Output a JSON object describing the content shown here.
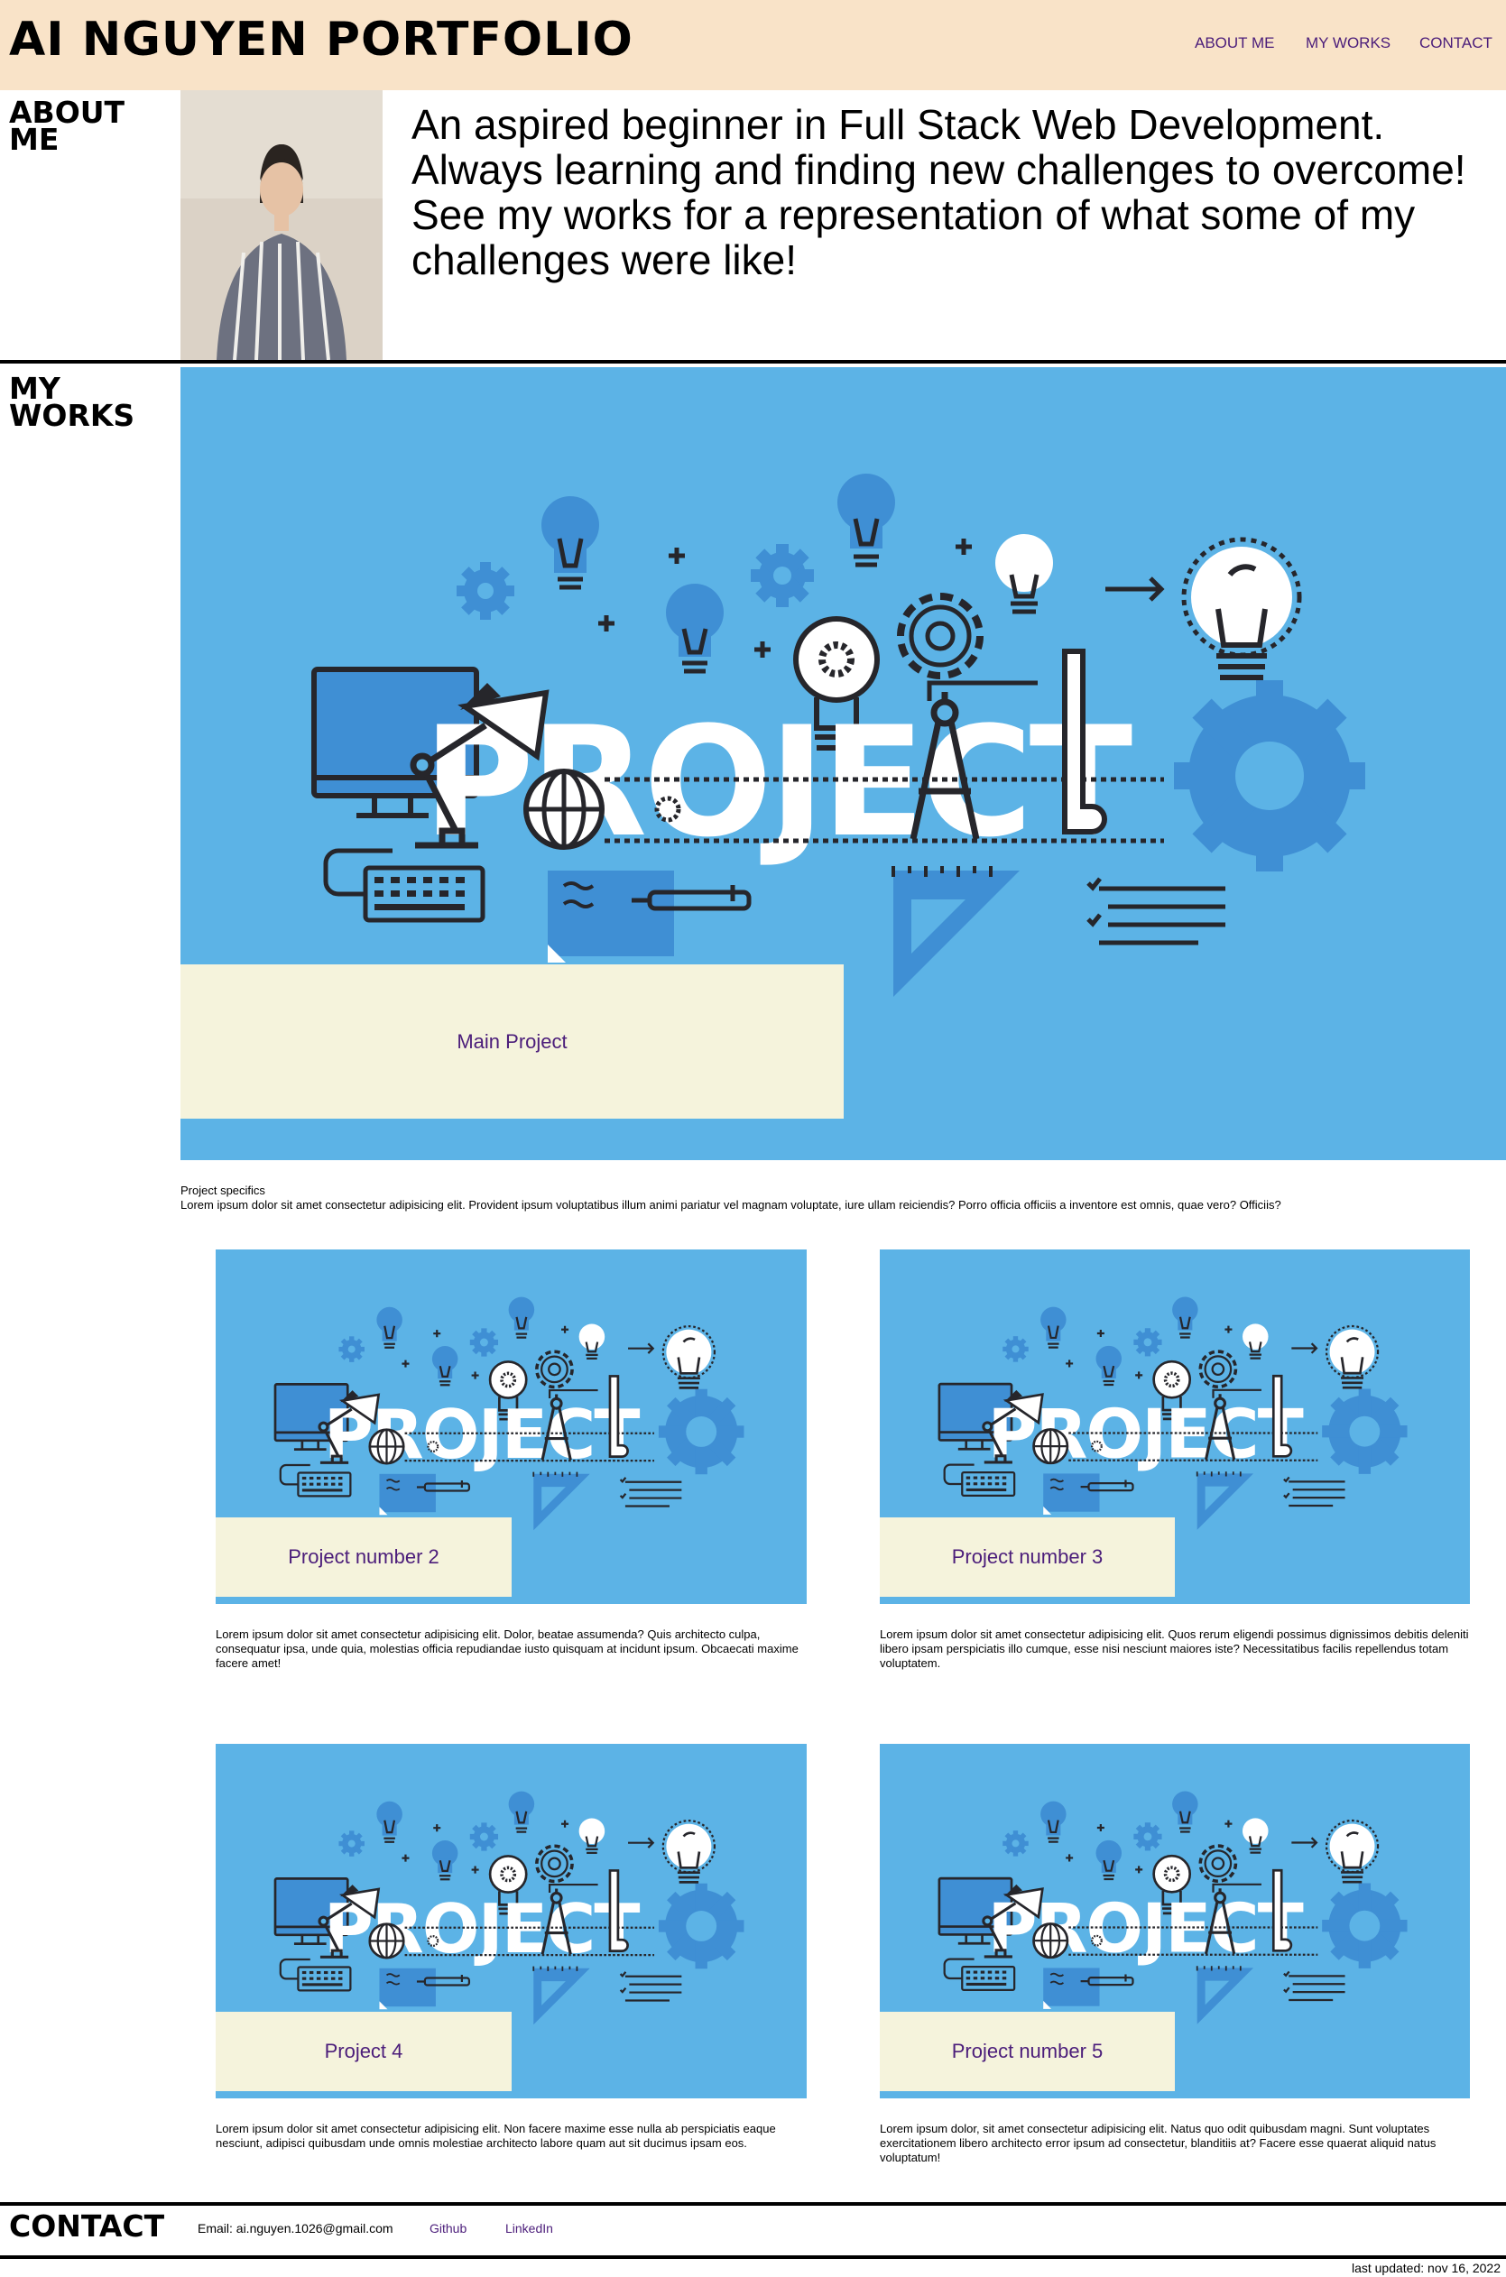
{
  "header": {
    "title": "AI NGUYEN PORTFOLIO",
    "nav": [
      "ABOUT ME",
      "MY WORKS",
      "CONTACT"
    ]
  },
  "about": {
    "label": "ABOUT\nME",
    "text": "An aspired beginner in Full Stack Web Development. Always learning and finding new challenges to overcome! See my works for a representation of what some of my challenges were like!"
  },
  "works": {
    "label": "MY\nWORKS",
    "banner_word": "PROJECT",
    "main": {
      "label": "Main Project",
      "specifics_title": "Project specifics",
      "specifics_text": "Lorem ipsum dolor sit amet consectetur adipisicing elit. Provident ipsum voluptatibus illum animi pariatur vel magnam voluptate, iure ullam reiciendis? Porro officia officiis a inventore est omnis, quae vero? Officiis?"
    },
    "projects": [
      {
        "label": "Project number 2",
        "text": "Lorem ipsum dolor sit amet consectetur adipisicing elit. Dolor, beatae assumenda? Quis architecto culpa, consequatur ipsa, unde quia, molestias officia repudiandae iusto quisquam at incidunt ipsum. Obcaecati maxime facere amet!"
      },
      {
        "label": "Project number 3",
        "text": "Lorem ipsum dolor sit amet consectetur adipisicing elit. Quos rerum eligendi possimus dignissimos debitis deleniti libero ipsam perspiciatis illo cumque, esse nisi nesciunt maiores iste? Necessitatibus facilis repellendus totam voluptatem."
      },
      {
        "label": "Project 4",
        "text": "Lorem ipsum dolor sit amet consectetur adipisicing elit. Non facere maxime esse nulla ab perspiciatis eaque nesciunt, adipisci quibusdam unde omnis molestiae architecto labore quam aut sit ducimus ipsam eos."
      },
      {
        "label": "Project number 5",
        "text": "Lorem ipsum dolor, sit amet consectetur adipisicing elit. Natus quo odit quibusdam magni. Sunt voluptates exercitationem libero architecto error ipsum ad consectetur, blanditiis at? Facere esse quaerat aliquid natus voluptatum!"
      }
    ]
  },
  "contact": {
    "label": "CONTACT",
    "email": "Email: ai.nguyen.1026@gmail.com",
    "github": "Github",
    "linkedin": "LinkedIn"
  },
  "footer": {
    "updated": "last updated: nov 16, 2022"
  },
  "colors": {
    "header_bg": "#f9e3c8",
    "accent": "#4b1d7a",
    "card_bg": "#5cb3e6",
    "label_bg": "#f5f3dc"
  }
}
